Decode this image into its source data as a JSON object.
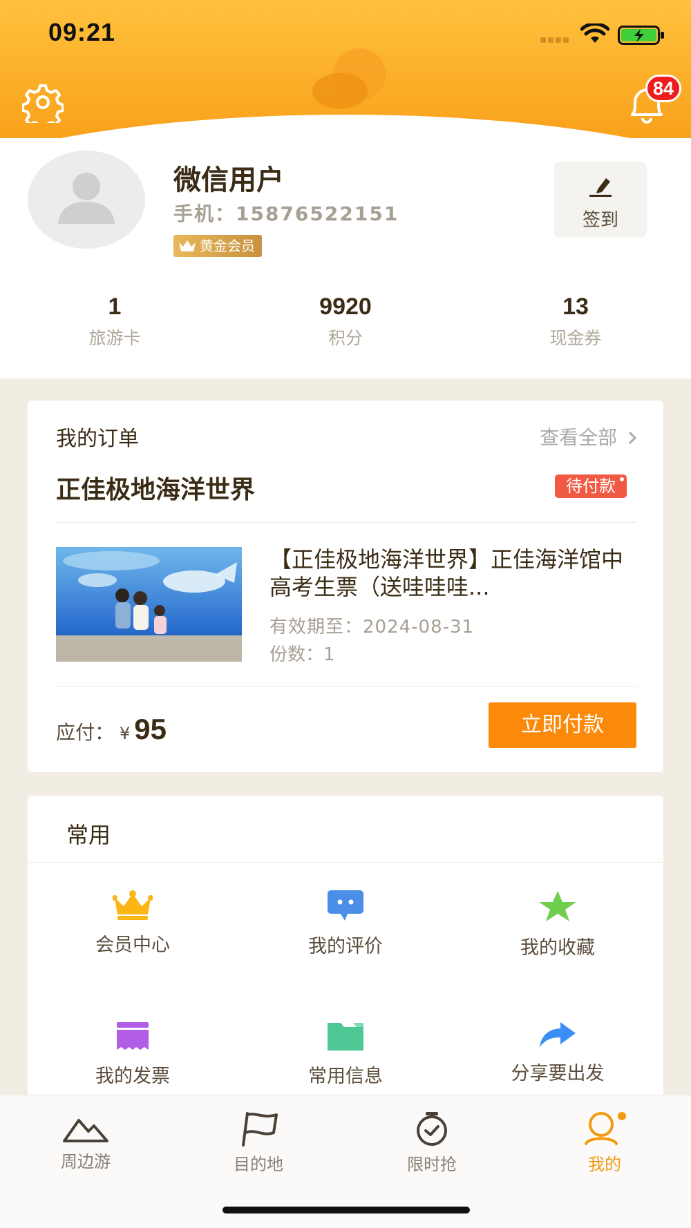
{
  "status_bar": {
    "time": "09:21"
  },
  "header": {
    "notification_count": "84"
  },
  "profile": {
    "username": "微信用户",
    "phone": "手机：15876522151",
    "member_level": "黄金会员",
    "sign_in_label": "签到",
    "stats": [
      {
        "value": "1",
        "label": "旅游卡"
      },
      {
        "value": "9920",
        "label": "积分"
      },
      {
        "value": "13",
        "label": "现金券"
      }
    ]
  },
  "orders": {
    "title": "我的订单",
    "view_all": "查看全部",
    "shop_name": "正佳极地海洋世界",
    "status": "待付款",
    "product_name": "【正佳极地海洋世界】正佳海洋馆中高考生票（送哇哇哇...",
    "valid_until": "有效期至：2024-08-31",
    "quantity": "份数：1",
    "pay_label": "应付：",
    "currency": "¥",
    "amount": "95",
    "pay_button": "立即付款"
  },
  "common": {
    "title": "常用",
    "items": [
      {
        "label": "会员中心",
        "icon": "crown-icon"
      },
      {
        "label": "我的评价",
        "icon": "comment-icon"
      },
      {
        "label": "我的收藏",
        "icon": "star-icon"
      },
      {
        "label": "我的发票",
        "icon": "invoice-icon"
      },
      {
        "label": "常用信息",
        "icon": "folder-icon"
      },
      {
        "label": "分享要出发",
        "icon": "share-icon"
      }
    ]
  },
  "tabbar": {
    "items": [
      {
        "label": "周边游",
        "icon": "mountain-icon",
        "active": false
      },
      {
        "label": "目的地",
        "icon": "flag-icon",
        "active": false
      },
      {
        "label": "限时抢",
        "icon": "stopwatch-icon",
        "active": false
      },
      {
        "label": "我的",
        "icon": "user-icon",
        "active": true
      }
    ]
  },
  "colors": {
    "brand_orange": "#fb8a0b",
    "header_top": "#ffc23d",
    "status_tag": "#f05a45",
    "badge_red": "#ee1c1c",
    "active_tab": "#f39a11"
  }
}
